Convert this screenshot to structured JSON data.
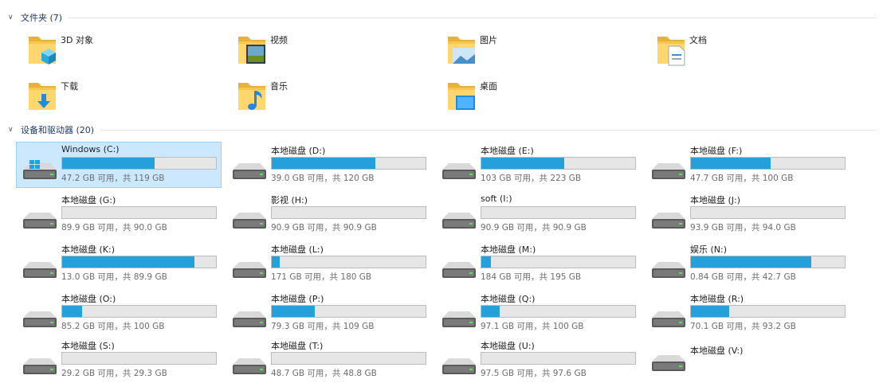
{
  "folders_section": {
    "title": "文件夹 (7)"
  },
  "folders": [
    {
      "name": "3D 对象",
      "icon": "3d-objects-icon"
    },
    {
      "name": "视频",
      "icon": "videos-icon"
    },
    {
      "name": "图片",
      "icon": "pictures-icon"
    },
    {
      "name": "文档",
      "icon": "documents-icon"
    },
    {
      "name": "下载",
      "icon": "downloads-icon"
    },
    {
      "name": "音乐",
      "icon": "music-icon"
    },
    {
      "name": "桌面",
      "icon": "desktop-icon"
    }
  ],
  "drives_section": {
    "title": "设备和驱动器 (20)"
  },
  "drives": [
    {
      "name": "Windows (C:)",
      "free": "47.2 GB 可用，共 119 GB",
      "used_fraction": 0.6,
      "selected": true,
      "icon": "windows-drive-icon"
    },
    {
      "name": "本地磁盘 (D:)",
      "free": "39.0 GB 可用，共 120 GB",
      "used_fraction": 0.675
    },
    {
      "name": "本地磁盘 (E:)",
      "free": "103 GB 可用，共 223 GB",
      "used_fraction": 0.54
    },
    {
      "name": "本地磁盘 (F:)",
      "free": "47.7 GB 可用，共 100 GB",
      "used_fraction": 0.52
    },
    {
      "name": "本地磁盘 (G:)",
      "free": "89.9 GB 可用，共 90.0 GB",
      "used_fraction": 0.0
    },
    {
      "name": "影视 (H:)",
      "free": "90.9 GB 可用，共 90.9 GB",
      "used_fraction": 0.0
    },
    {
      "name": "soft (I:)",
      "free": "90.9 GB 可用，共 90.9 GB",
      "used_fraction": 0.0
    },
    {
      "name": "本地磁盘 (J:)",
      "free": "93.9 GB 可用，共 94.0 GB",
      "used_fraction": 0.0
    },
    {
      "name": "本地磁盘 (K:)",
      "free": "13.0 GB 可用，共 89.9 GB",
      "used_fraction": 0.86
    },
    {
      "name": "本地磁盘 (L:)",
      "free": "171 GB 可用，共 180 GB",
      "used_fraction": 0.05
    },
    {
      "name": "本地磁盘 (M:)",
      "free": "184 GB 可用，共 195 GB",
      "used_fraction": 0.06
    },
    {
      "name": "娱乐 (N:)",
      "free": "0.84 GB 可用，共 42.7 GB",
      "used_fraction": 0.78
    },
    {
      "name": "本地磁盘 (O:)",
      "free": "85.2 GB 可用，共 100 GB",
      "used_fraction": 0.13
    },
    {
      "name": "本地磁盘 (P:)",
      "free": "79.3 GB 可用，共 109 GB",
      "used_fraction": 0.28
    },
    {
      "name": "本地磁盘 (Q:)",
      "free": "97.1 GB 可用，共 100 GB",
      "used_fraction": 0.12
    },
    {
      "name": "本地磁盘 (R:)",
      "free": "70.1 GB 可用，共 93.2 GB",
      "used_fraction": 0.25
    },
    {
      "name": "本地磁盘 (S:)",
      "free": "29.2 GB 可用，共 29.3 GB",
      "used_fraction": 0.0
    },
    {
      "name": "本地磁盘 (T:)",
      "free": "48.7 GB 可用，共 48.8 GB",
      "used_fraction": 0.0
    },
    {
      "name": "本地磁盘 (U:)",
      "free": "97.5 GB 可用，共 97.6 GB",
      "used_fraction": 0.0
    },
    {
      "name": "本地磁盘 (V:)",
      "free": "",
      "used_fraction": null
    }
  ],
  "colors": {
    "bar_fill": "#26a0da",
    "bar_track": "#e6e6e6",
    "selection": "#cce8ff",
    "header_text": "#1e3a6e"
  }
}
